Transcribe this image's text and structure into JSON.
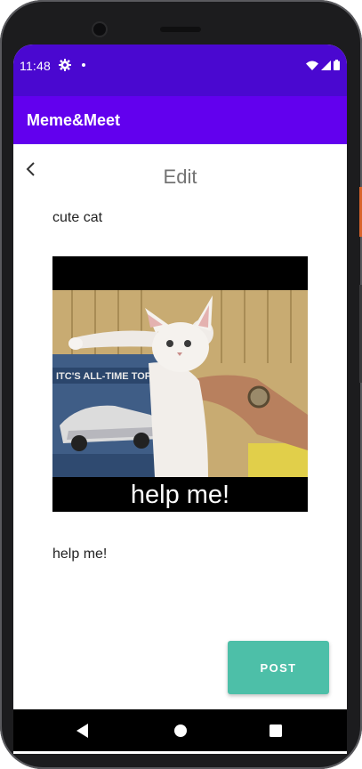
{
  "status_bar": {
    "time": "11:48",
    "icons": [
      "settings-gear-icon",
      "notification-dot-icon",
      "wifi-icon",
      "signal-icon",
      "battery-icon"
    ]
  },
  "app_bar": {
    "title": "Meme&Meet",
    "color": "#6200ee"
  },
  "page": {
    "title": "Edit",
    "back_icon": "chevron-left-icon",
    "top_caption": "cute cat",
    "bottom_caption": "help me!"
  },
  "meme": {
    "overlay_text": "help me!",
    "image_subject": "cat-photo"
  },
  "post_button": {
    "label": "POST",
    "color": "#4dbfa8"
  },
  "nav_bar": {
    "icons": [
      "nav-back-icon",
      "nav-home-icon",
      "nav-recents-icon"
    ]
  }
}
